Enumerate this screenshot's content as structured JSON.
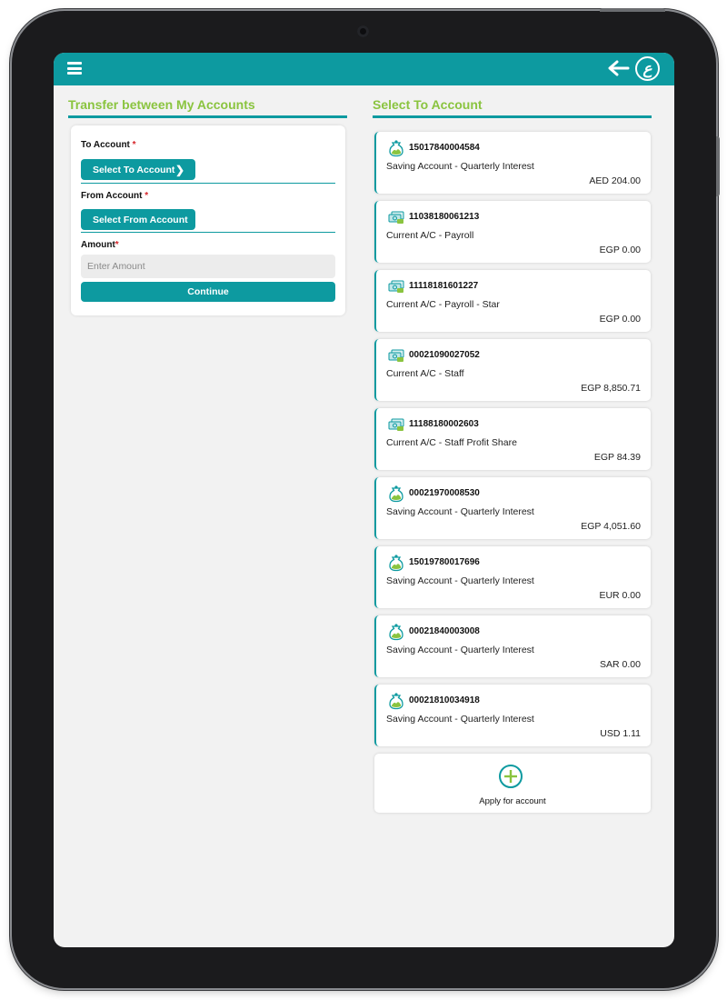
{
  "header": {
    "menu_icon": "hamburger-menu-icon",
    "back_icon": "arrow-left-icon",
    "logo_glyph": "ع"
  },
  "colors": {
    "brand_teal": "#0d9aa0",
    "accent_green": "#8ac43f",
    "required_red": "#d6262b"
  },
  "transfer": {
    "title": "Transfer between My Accounts",
    "to_label": "To Account",
    "from_label": "From Account",
    "amount_label": "Amount",
    "required_mark": "*",
    "select_to_button": "Select To Account",
    "select_from_button": "Select From Account",
    "amount_placeholder": "Enter Amount",
    "continue_button": "Continue"
  },
  "select_to": {
    "title": "Select To Account",
    "accounts": [
      {
        "number": "15017840004584",
        "type": "Saving Account - Quarterly Interest",
        "balance": "AED 204.00",
        "icon": "savings-jar-icon"
      },
      {
        "number": "11038180061213",
        "type": "Current A/C - Payroll",
        "balance": "EGP 0.00",
        "icon": "cash-stack-icon"
      },
      {
        "number": "11118181601227",
        "type": "Current A/C - Payroll - Star",
        "balance": "EGP 0.00",
        "icon": "cash-stack-icon"
      },
      {
        "number": "00021090027052",
        "type": "Current A/C - Staff",
        "balance": "EGP 8,850.71",
        "icon": "cash-stack-icon"
      },
      {
        "number": "11188180002603",
        "type": "Current A/C - Staff Profit Share",
        "balance": "EGP 84.39",
        "icon": "cash-stack-icon"
      },
      {
        "number": "00021970008530",
        "type": "Saving Account - Quarterly Interest",
        "balance": "EGP 4,051.60",
        "icon": "savings-jar-icon"
      },
      {
        "number": "15019780017696",
        "type": "Saving Account - Quarterly Interest",
        "balance": "EUR 0.00",
        "icon": "savings-jar-icon"
      },
      {
        "number": "00021840003008",
        "type": "Saving Account - Quarterly Interest",
        "balance": "SAR 0.00",
        "icon": "savings-jar-icon"
      },
      {
        "number": "00021810034918",
        "type": "Saving Account - Quarterly Interest",
        "balance": "USD 1.11",
        "icon": "savings-jar-icon"
      }
    ],
    "apply_label": "Apply for account"
  }
}
